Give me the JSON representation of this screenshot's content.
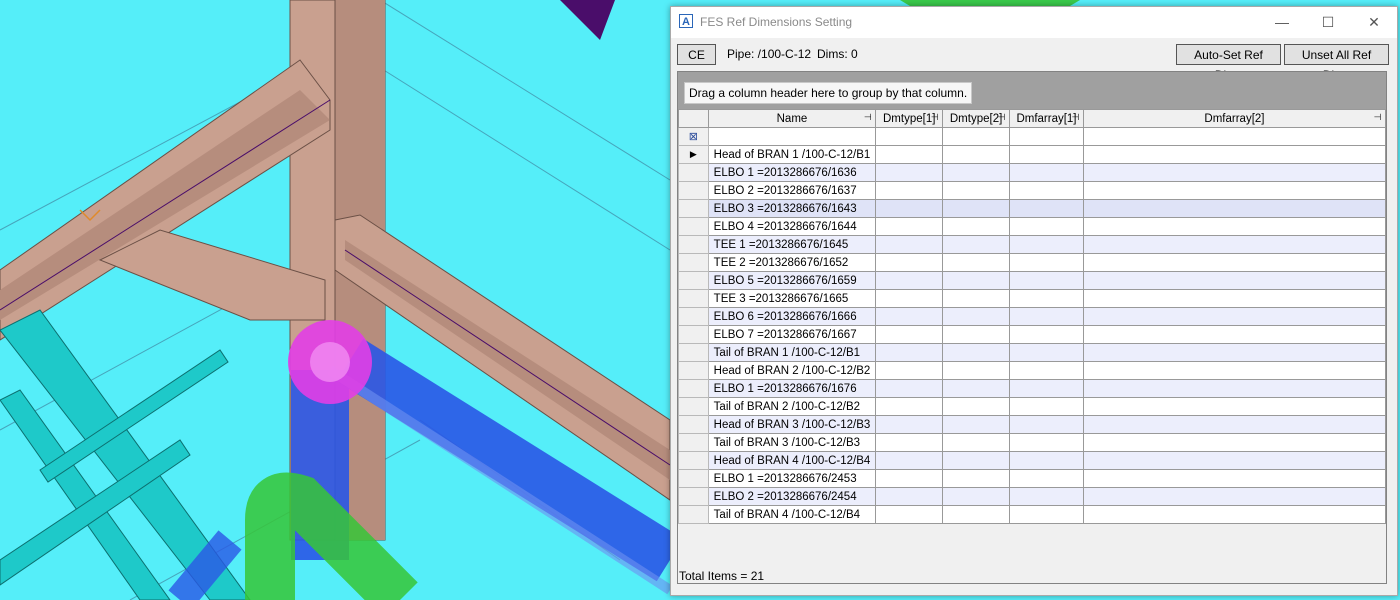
{
  "dialog": {
    "title": "FES Ref Dimensions Setting",
    "ce_button": "CE",
    "pipe_label": "Pipe: /100-C-12",
    "dims_label": "Dims: 0",
    "auto_set_button": "Auto-Set Ref Dims",
    "unset_all_button": "Unset All Ref Dims",
    "window_controls": {
      "minimize": "—",
      "maximize": "☐",
      "close": "✕"
    }
  },
  "grid": {
    "group_hint": "Drag a column header here to group by that column.",
    "columns": [
      "Name",
      "Dmtype[1]",
      "Dmtype[2]",
      "Dmfarray[1]",
      "Dmfarray[2]"
    ],
    "rows": [
      "Head of BRAN 1 /100-C-12/B1",
      "ELBO 1 =2013286676/1636",
      "ELBO 2 =2013286676/1637",
      "ELBO 3 =2013286676/1643",
      "ELBO 4 =2013286676/1644",
      "TEE 1 =2013286676/1645",
      "TEE 2 =2013286676/1652",
      "ELBO 5 =2013286676/1659",
      "TEE 3 =2013286676/1665",
      "ELBO 6 =2013286676/1666",
      "ELBO 7 =2013286676/1667",
      "Tail of BRAN 1 /100-C-12/B1",
      "Head of BRAN 2 /100-C-12/B2",
      "ELBO 1 =2013286676/1676",
      "Tail of BRAN 2 /100-C-12/B2",
      "Head of BRAN 3 /100-C-12/B3",
      "Tail of BRAN 3 /100-C-12/B3",
      "Head of BRAN 4 /100-C-12/B4",
      "ELBO 1 =2013286676/2453",
      "ELBO 2 =2013286676/2454",
      "Tail of BRAN 4 /100-C-12/B4"
    ],
    "total_items": "Total Items = 21"
  },
  "icons": {
    "app": "app-icon",
    "filter": "filter-icon",
    "current_row": "current-row-arrow-icon",
    "pin": "pin-icon"
  },
  "colors": {
    "viewport_bg": "#55eef9",
    "steel": "#c9a08f",
    "pipe_blue": "#2a57e6",
    "pipe_green": "#37c537",
    "selected_elbow": "#e23ee6",
    "alt_row": "#eceefc"
  }
}
